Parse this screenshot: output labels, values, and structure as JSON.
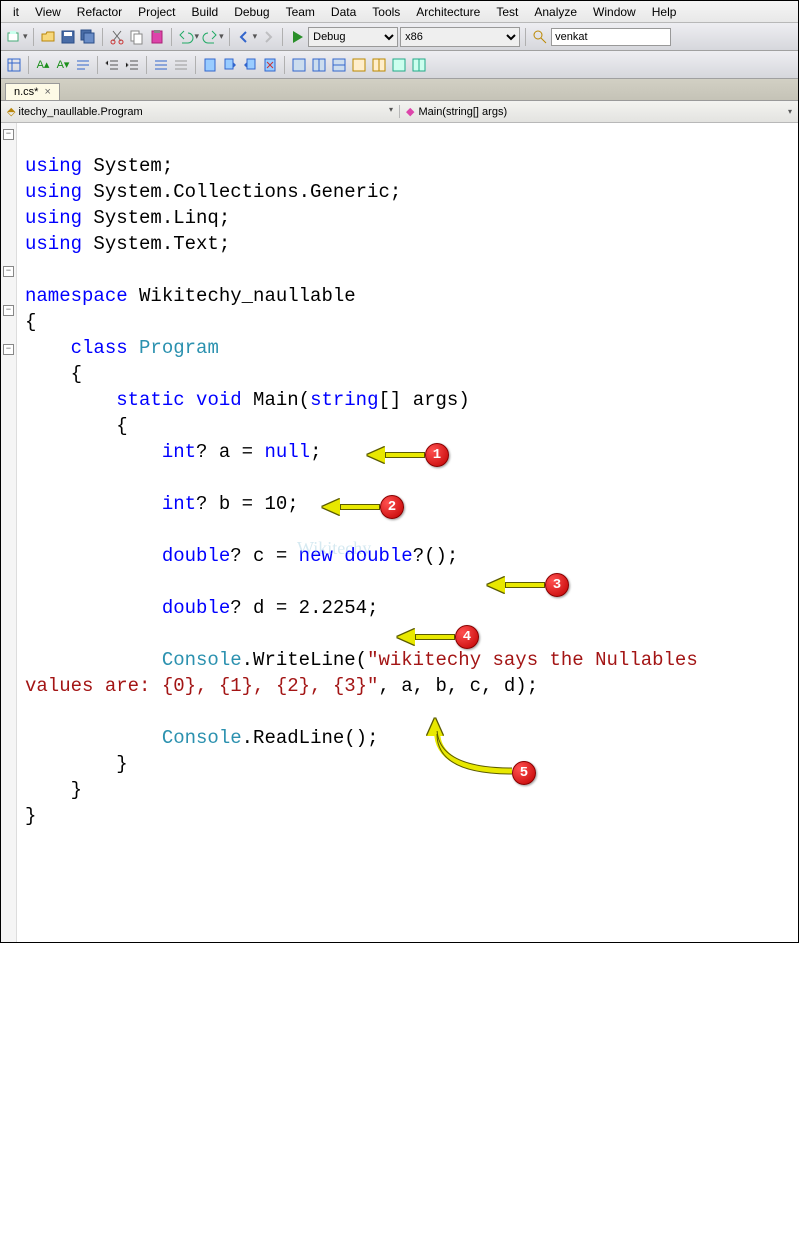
{
  "menu": {
    "items": [
      "it",
      "View",
      "Refactor",
      "Project",
      "Build",
      "Debug",
      "Team",
      "Data",
      "Tools",
      "Architecture",
      "Test",
      "Analyze",
      "Window",
      "Help"
    ]
  },
  "toolbar": {
    "config_options": [
      "Debug"
    ],
    "config_selected": "Debug",
    "platform_options": [
      "x86"
    ],
    "platform_selected": "x86",
    "search_value": "venkat"
  },
  "tab": {
    "label": "n.cs*",
    "close": "×"
  },
  "nav": {
    "left": "itechy_naullable.Program",
    "right": "Main(string[] args)"
  },
  "code": {
    "l1_kw": "using",
    "l1_ns": " System;",
    "l2_kw": "using",
    "l2_ns": " System.Collections.Generic;",
    "l3_kw": "using",
    "l3_ns": " System.Linq;",
    "l4_kw": "using",
    "l4_ns": " System.Text;",
    "l6_kw": "namespace",
    "l6_id": " Wikitechy_naullable",
    "l7": "{",
    "l8_ind": "    ",
    "l8_kw": "class",
    "l8_sp": " ",
    "l8_tp": "Program",
    "l9": "    {",
    "l10_ind": "        ",
    "l10_kw1": "static",
    "l10_sp1": " ",
    "l10_kw2": "void",
    "l10_sp2": " Main(",
    "l10_kw3": "string",
    "l10_tail": "[] args)",
    "l11": "        {",
    "l12_ind": "            ",
    "l12_kw": "int",
    "l12_mid": "? a = ",
    "l12_kw2": "null",
    "l12_tail": ";",
    "l14_ind": "            ",
    "l14_kw": "int",
    "l14_tail": "? b = 10;",
    "l16_ind": "            ",
    "l16_kw": "double",
    "l16_mid": "? c = ",
    "l16_kw2": "new",
    "l16_sp": " ",
    "l16_kw3": "double",
    "l16_tail": "?();",
    "l18_ind": "            ",
    "l18_kw": "double",
    "l18_tail": "? d = 2.2254;",
    "l20_ind": "            ",
    "l20_tp": "Console",
    "l20_mid": ".WriteLine(",
    "l20_str": "\"wikitechy says the Nullables \nvalues are: {0}, {1}, {2}, {3}\"",
    "l20_tail": ", a, b, c, d);",
    "l22_ind": "            ",
    "l22_tp": "Console",
    "l22_tail": ".ReadLine();",
    "l23": "        }",
    "l24": "    }",
    "l25": "}"
  },
  "annotations": {
    "n1": "1",
    "n2": "2",
    "n3": "3",
    "n4": "4",
    "n5": "5"
  },
  "watermark": "Wikitechy"
}
